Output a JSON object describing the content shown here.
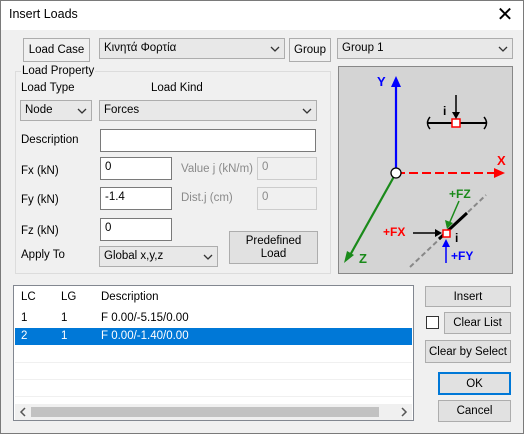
{
  "window": {
    "title": "Insert Loads",
    "close_glyph": "✕"
  },
  "load_case": {
    "label": "Load Case",
    "value": "Κινητά Φορτία"
  },
  "group": {
    "label": "Group",
    "value": "Group 1"
  },
  "load_property": {
    "title": "Load Property",
    "load_type_label": "Load Type",
    "load_kind_label": "Load Kind",
    "load_type_value": "Node",
    "load_kind_value": "Forces",
    "description_label": "Description",
    "description_value": "",
    "fx_label": "Fx (kN)",
    "fx_value": "0",
    "fy_label": "Fy (kN)",
    "fy_value": "-1.4",
    "fz_label": "Fz (kN)",
    "fz_value": "0",
    "value_j_label": "Value j (kN/m)",
    "value_j_value": "0",
    "dist_j_label": "Dist.j (cm)",
    "dist_j_value": "0",
    "apply_to_label": "Apply To",
    "apply_to_value": "Global x,y,z",
    "predefined_line1": "Predefined",
    "predefined_line2": "Load"
  },
  "diagram": {
    "axis_y": "Y",
    "axis_x": "X",
    "axis_z": "Z",
    "node_label": "i",
    "member_node_label": "i",
    "fx_label": "+FX",
    "fy_label": "+FY",
    "fz_label": "+FZ",
    "colors": {
      "y_axis": "#0000ff",
      "x_axis": "#ff0000",
      "z_axis": "#1a8a1a",
      "bg": "#d4d4d4"
    }
  },
  "loads_list": {
    "columns": [
      "LC",
      "LG",
      "Description"
    ],
    "rows": [
      {
        "lc": "1",
        "lg": "1",
        "description": "F  0.00/-5.15/0.00",
        "selected": false
      },
      {
        "lc": "2",
        "lg": "1",
        "description": "F  0.00/-1.40/0.00",
        "selected": true
      }
    ]
  },
  "buttons": {
    "insert": "Insert",
    "clear_list": "Clear List",
    "clear_by_select": "Clear by Select",
    "ok": "OK",
    "cancel": "Cancel"
  },
  "icons": {
    "dropdown": "chevron-down-icon",
    "close": "close-icon"
  },
  "accent_color": "#0078d7"
}
